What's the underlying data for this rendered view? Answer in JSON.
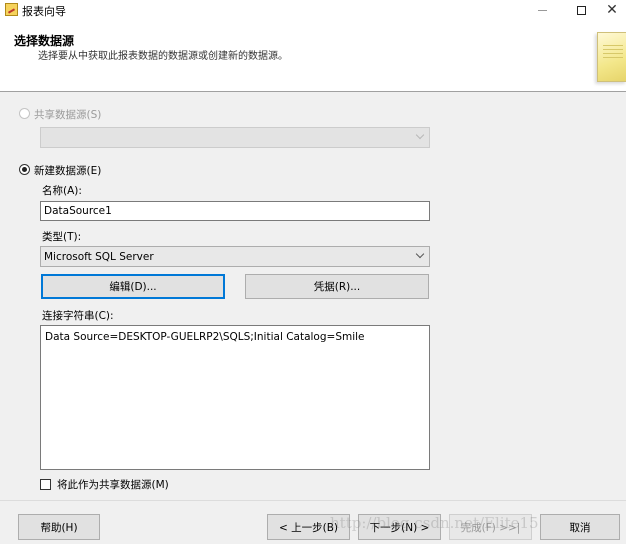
{
  "window": {
    "title": "报表向导",
    "icon": "report-wizard-icon",
    "controls": [
      "minimize-icon",
      "maximize-icon",
      "close-icon"
    ],
    "close_glyph": "✕"
  },
  "header": {
    "title": "选择数据源",
    "subtitle": "选择要从中获取此报表数据的数据源或创建新的数据源。"
  },
  "shared_source": {
    "label": "共享数据源(S)",
    "selected": false,
    "enabled": false,
    "combo_value": ""
  },
  "new_source": {
    "label": "新建数据源(E)",
    "selected": true,
    "name_label": "名称(A):",
    "name_value": "DataSource1",
    "type_label": "类型(T):",
    "type_value": "Microsoft SQL Server",
    "edit_button": "编辑(D)...",
    "credentials_button": "凭据(R)...",
    "connection_label": "连接字符串(C):",
    "connection_string": "Data Source=DESKTOP-GUELRP2\\SQLS;Initial Catalog=Smile",
    "make_shared_label": "将此作为共享数据源(M)",
    "make_shared_checked": false
  },
  "footer": {
    "help": "帮助(H)",
    "back": "< 上一步(B)",
    "next": "下一步(N) >",
    "finish": "完成(F) >>|",
    "cancel": "取消"
  },
  "watermark": "http://blog.csdn.net/Elite15"
}
